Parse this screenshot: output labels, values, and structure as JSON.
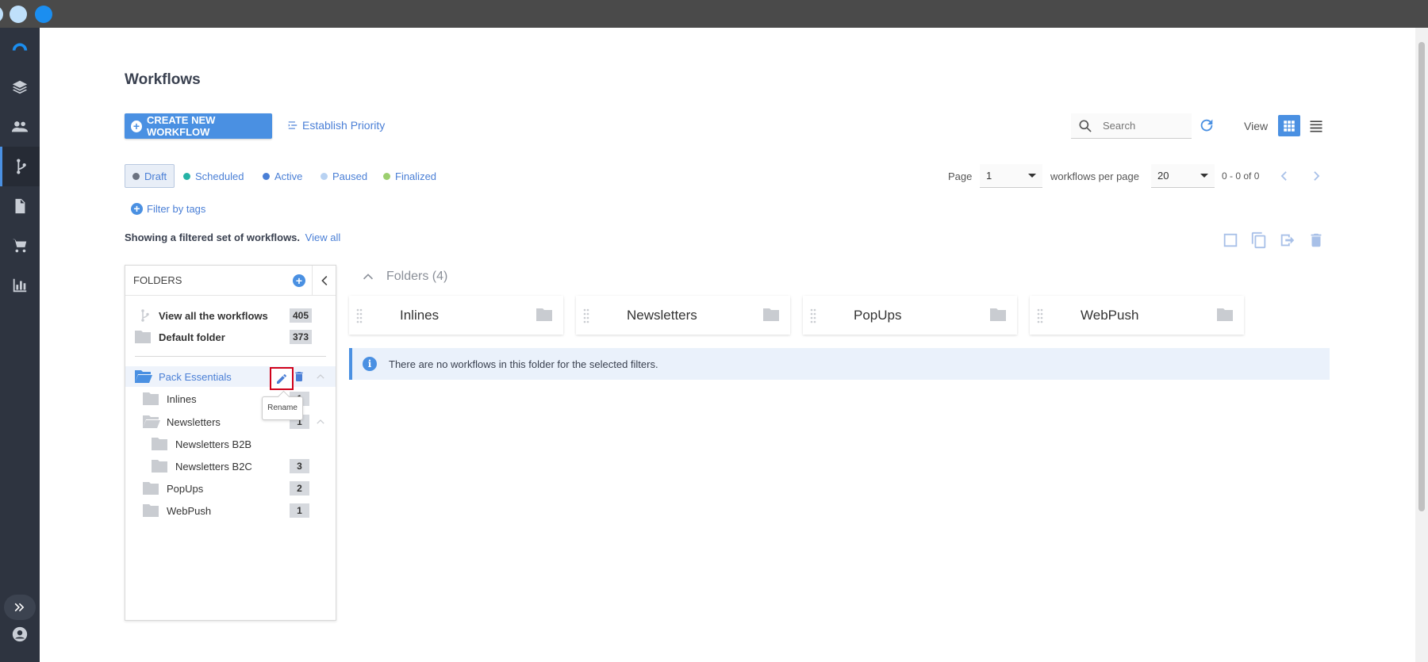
{
  "page": {
    "title": "Workflows"
  },
  "toolbar": {
    "create_label": "CREATE NEW WORKFLOW",
    "priority_label": "Establish Priority",
    "search_placeholder": "Search",
    "view_label": "View"
  },
  "status_filters": [
    {
      "label": "Draft",
      "color": "#6b7280",
      "selected": true
    },
    {
      "label": "Scheduled",
      "color": "#26b3a6",
      "selected": false
    },
    {
      "label": "Active",
      "color": "#4a7fd6",
      "selected": false
    },
    {
      "label": "Paused",
      "color": "#b8d2f2",
      "selected": false
    },
    {
      "label": "Finalized",
      "color": "#9ccf6f",
      "selected": false
    }
  ],
  "pagination": {
    "page_label": "Page",
    "page_value": "1",
    "per_page_label": "workflows per page",
    "per_page_value": "20",
    "range": "0 - 0 of 0"
  },
  "filter_tags_label": "Filter by tags",
  "filtered_note": {
    "text": "Showing a filtered set of workflows.",
    "link": "View all"
  },
  "folders_panel": {
    "title": "FOLDERS",
    "items": [
      {
        "label": "View all the workflows",
        "count": "405"
      },
      {
        "label": "Default folder",
        "count": "373"
      },
      {
        "label": "Pack Essentials",
        "count": ""
      },
      {
        "label": "Inlines",
        "count": "1"
      },
      {
        "label": "Newsletters",
        "count": "1"
      },
      {
        "label": "Newsletters B2B",
        "count": ""
      },
      {
        "label": "Newsletters B2C",
        "count": "3"
      },
      {
        "label": "PopUps",
        "count": "2"
      },
      {
        "label": "WebPush",
        "count": "1"
      }
    ],
    "tooltip": "Rename"
  },
  "folders_section": {
    "heading": "Folders (4)",
    "cards": [
      "Inlines",
      "Newsletters",
      "PopUps",
      "WebPush"
    ]
  },
  "info_message": "There are no workflows in this folder for the selected filters.",
  "colors": {
    "accent": "#4a90e2",
    "sidebar": "#2e3440",
    "highlight": "#d0021b"
  }
}
